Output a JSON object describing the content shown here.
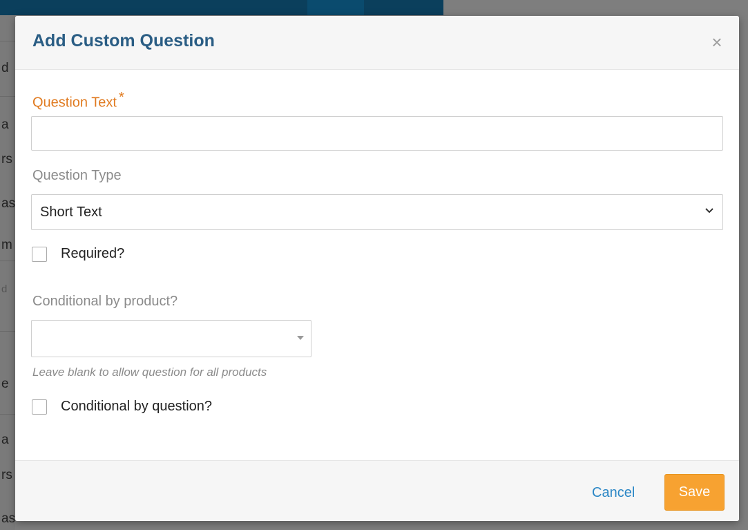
{
  "modal": {
    "title": "Add Custom Question",
    "close_glyph": "×"
  },
  "form": {
    "question_text": {
      "label": "Question Text",
      "required_marker": "*",
      "value": ""
    },
    "question_type": {
      "label": "Question Type",
      "selected": "Short Text"
    },
    "required_checkbox": {
      "label": "Required?",
      "checked": false
    },
    "conditional_product": {
      "label": "Conditional by product?",
      "selected": "",
      "help": "Leave blank to allow question for all products"
    },
    "conditional_question_checkbox": {
      "label": "Conditional by question?",
      "checked": false
    }
  },
  "footer": {
    "cancel_label": "Cancel",
    "save_label": "Save"
  },
  "colors": {
    "title": "#2a5d84",
    "required_label": "#e07a1f",
    "link": "#2a86c5",
    "save_button": "#f7a231"
  },
  "background_fragments": [
    "d",
    "a",
    "rs",
    "as",
    "m",
    "d",
    "e",
    "a",
    "rs",
    "as"
  ]
}
